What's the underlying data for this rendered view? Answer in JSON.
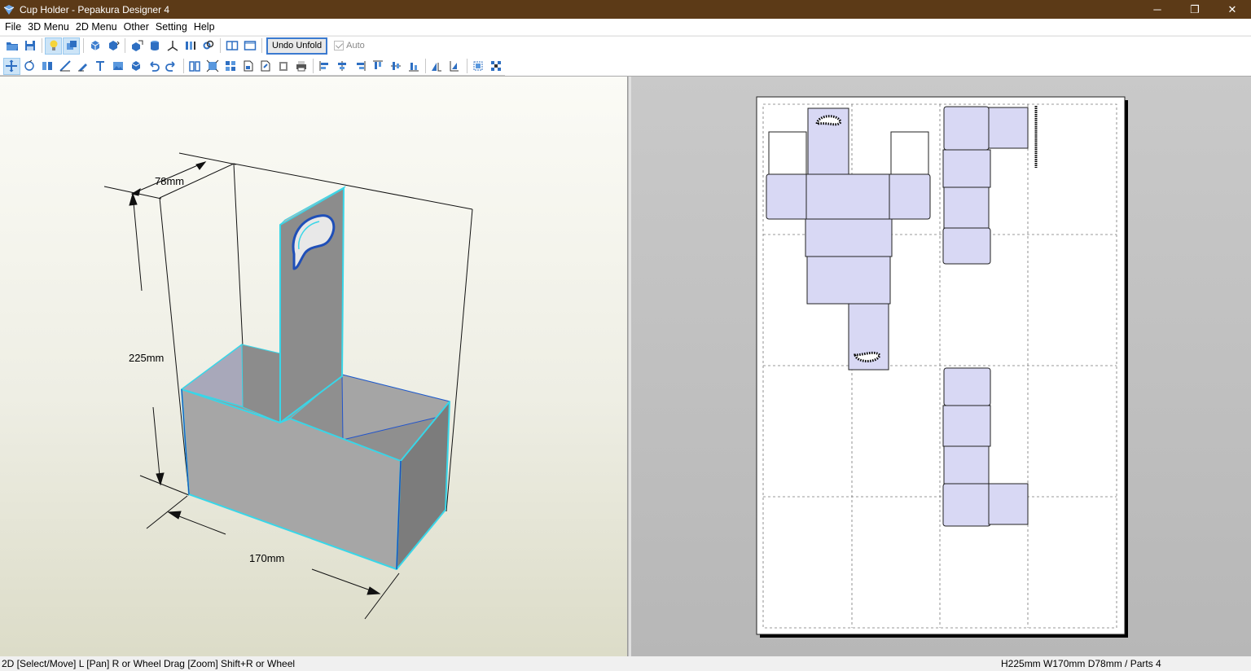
{
  "window": {
    "title": "Cup Holder - Pepakura Designer 4",
    "controls": {
      "minimize": "─",
      "restore": "❐",
      "close": "✕"
    }
  },
  "menu": [
    "File",
    "3D Menu",
    "2D Menu",
    "Other",
    "Setting",
    "Help"
  ],
  "toolbar1": {
    "undo_unfold_label": "Undo Unfold",
    "auto_label": "Auto",
    "auto_checked": true
  },
  "view3d": {
    "dimensions": {
      "depth": "78mm",
      "height": "225mm",
      "width": "170mm"
    },
    "model_fill": "#a9a9a9",
    "edge_highlight": "#38d6e8"
  },
  "view2d": {
    "part_fill": "#d8d8f4",
    "page_background": "#ffffff"
  },
  "status": {
    "hint": "2D [Select/Move] L [Pan] R or Wheel Drag [Zoom] Shift+R or Wheel",
    "info": "H225mm W170mm D78mm / Parts 4"
  }
}
